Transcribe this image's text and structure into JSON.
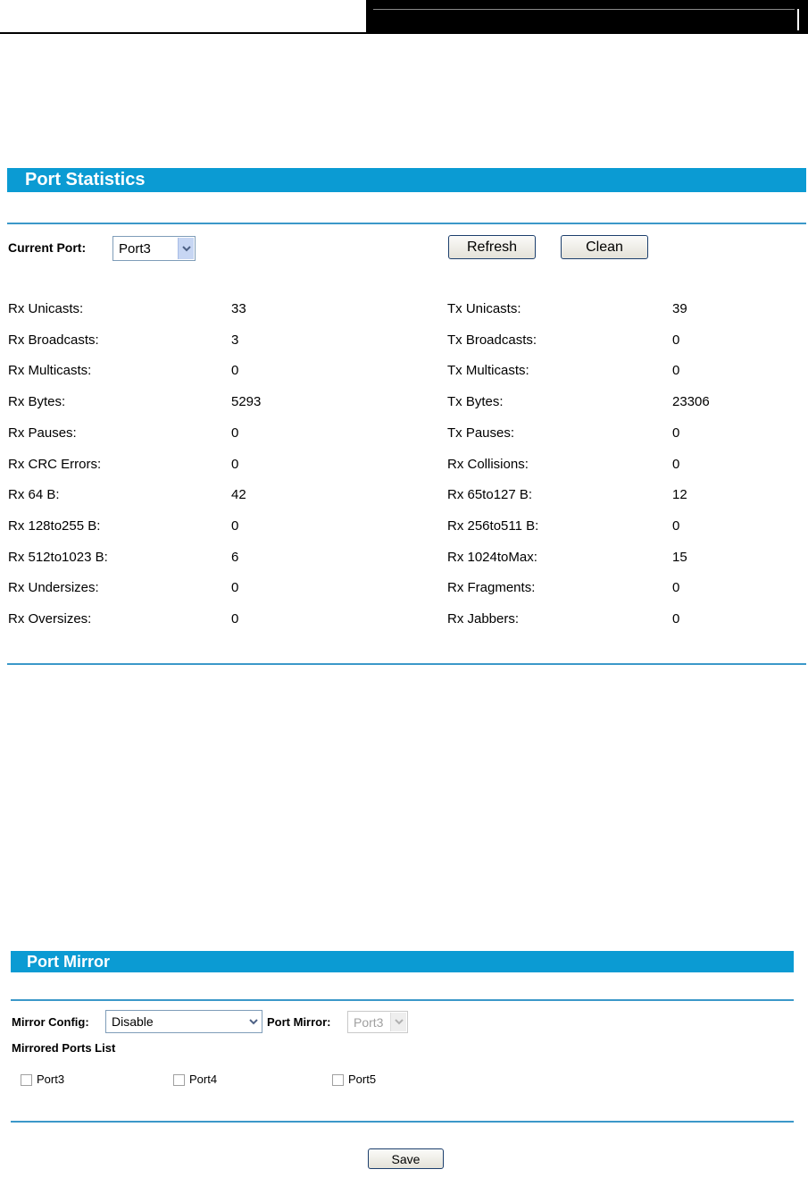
{
  "port_statistics": {
    "title": "Port Statistics",
    "current_port_label": "Current Port:",
    "current_port_value": "Port3",
    "refresh_label": "Refresh",
    "clean_label": "Clean",
    "rows": [
      {
        "rx_label": "Rx Unicasts:",
        "rx_value": "33",
        "tx_label": "Tx Unicasts:",
        "tx_value": "39"
      },
      {
        "rx_label": "Rx Broadcasts:",
        "rx_value": "3",
        "tx_label": "Tx Broadcasts:",
        "tx_value": "0"
      },
      {
        "rx_label": "Rx Multicasts:",
        "rx_value": "0",
        "tx_label": "Tx Multicasts:",
        "tx_value": "0"
      },
      {
        "rx_label": "Rx Bytes:",
        "rx_value": "5293",
        "tx_label": "Tx Bytes:",
        "tx_value": "23306"
      },
      {
        "rx_label": "Rx Pauses:",
        "rx_value": "0",
        "tx_label": "Tx Pauses:",
        "tx_value": "0"
      },
      {
        "rx_label": "Rx CRC Errors:",
        "rx_value": "0",
        "tx_label": "Rx Collisions:",
        "tx_value": "0"
      },
      {
        "rx_label": "Rx 64 B:",
        "rx_value": "42",
        "tx_label": "Rx 65to127 B:",
        "tx_value": "12"
      },
      {
        "rx_label": "Rx 128to255 B:",
        "rx_value": "0",
        "tx_label": "Rx 256to511 B:",
        "tx_value": "0"
      },
      {
        "rx_label": "Rx 512to1023 B:",
        "rx_value": "6",
        "tx_label": "Rx 1024toMax:",
        "tx_value": "15"
      },
      {
        "rx_label": "Rx Undersizes:",
        "rx_value": "0",
        "tx_label": "Rx Fragments:",
        "tx_value": "0"
      },
      {
        "rx_label": "Rx Oversizes:",
        "rx_value": "0",
        "tx_label": "Rx Jabbers:",
        "tx_value": "0"
      }
    ]
  },
  "port_mirror": {
    "title": "Port Mirror",
    "mirror_config_label": "Mirror Config:",
    "mirror_config_value": "Disable",
    "port_mirror_label": "Port Mirror:",
    "port_mirror_value": "Port3",
    "mirrored_ports_label": "Mirrored Ports List",
    "ports": [
      {
        "label": "Port3",
        "checked": false
      },
      {
        "label": "Port4",
        "checked": false
      },
      {
        "label": "Port5",
        "checked": false
      }
    ],
    "save_label": "Save"
  },
  "colors": {
    "title_bar": "#0b9bd3",
    "rule": "#3b98c9"
  }
}
